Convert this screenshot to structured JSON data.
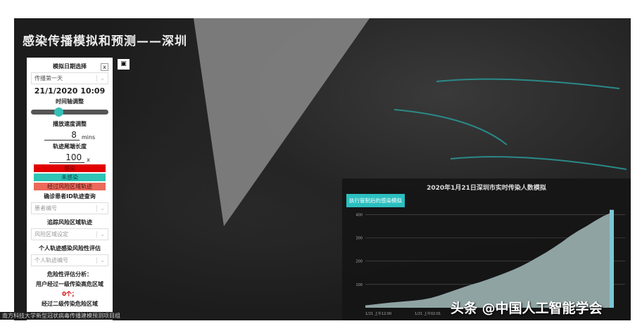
{
  "title": "感染传播模拟和预测——深圳",
  "panel": {
    "date_label": "模拟日期选择",
    "close": "x",
    "day_select": "传播第一天",
    "datetime": "21/1/2020 10:09",
    "timeline_label": "时间轴调整",
    "timeline_value": 0.3,
    "speed_label": "播放速度调整",
    "speed_value": "8",
    "speed_unit": "mins",
    "trail_label": "轨迹尾端长度",
    "trail_value": "100",
    "trail_unit": "x",
    "legend": [
      {
        "label": "感染",
        "color": "#e00000"
      },
      {
        "label": "未感染",
        "color": "#2ec4b6"
      },
      {
        "label": "经过风险区域轨迹",
        "color": "#ec6a5a"
      }
    ],
    "patient_label": "确诊患者ID轨迹查询",
    "patient_placeholder": "患者编号",
    "risk_label": "追踪风险区域轨迹",
    "risk_placeholder": "风险区域设定",
    "personal_label": "个人轨迹感染风险性评估",
    "personal_placeholder": "个人轨迹编号",
    "analysis_title": "危险性评估分析：",
    "analysis_line1": "用户经过一级传染高危区域",
    "analysis_count": "0个；",
    "analysis_line2": "经过二级传染危险区域"
  },
  "caption": "南方科技大学新型冠状病毒传播建模预测项目组",
  "watermark": "头条 @中国人工智能学会",
  "chart_button": "执行管制后的感染模拟",
  "chart_data": {
    "type": "area",
    "title": "2020年1月21日深圳市实时传染人数模拟",
    "xticks": [
      "1/21 上午12:00",
      "1/21 上午02:01"
    ],
    "yticks": [
      100,
      200,
      300,
      400
    ],
    "ylim": [
      0,
      410
    ],
    "values": [
      10,
      14,
      18,
      22,
      25,
      28,
      31,
      35,
      42,
      52,
      64,
      76,
      88,
      100,
      110,
      122,
      135,
      148,
      162,
      178,
      196,
      216,
      236,
      258,
      282,
      308,
      330,
      350,
      372,
      392,
      408
    ]
  }
}
